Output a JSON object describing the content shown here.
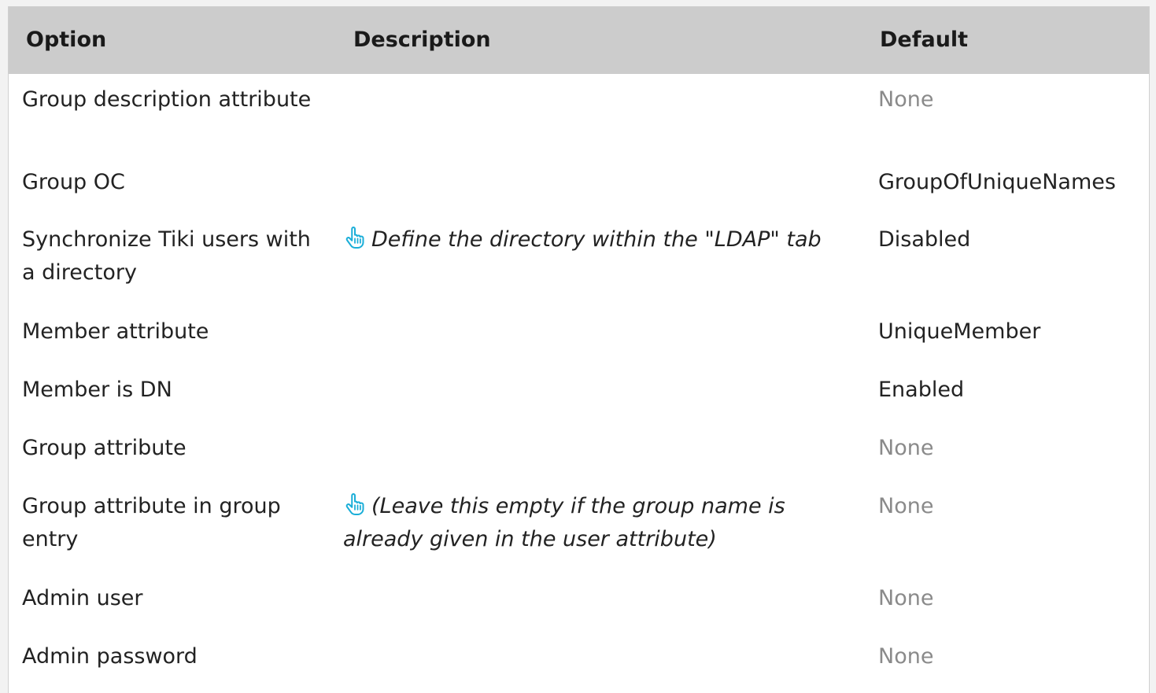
{
  "table": {
    "headers": {
      "option": "Option",
      "description": "Description",
      "default": "Default"
    },
    "rows": [
      {
        "option": "Group description attribute",
        "description": "",
        "default": "None",
        "default_muted": true
      },
      {
        "option": "Group OC",
        "description": "",
        "default": "GroupOfUniqueNames",
        "default_muted": false
      },
      {
        "option": "Synchronize Tiki users with a directory",
        "description": "Define the directory within the \"LDAP\" tab",
        "default": "Disabled",
        "default_muted": false,
        "has_hand_icon": true
      },
      {
        "option": "Member attribute",
        "description": "",
        "default": "UniqueMember",
        "default_muted": false
      },
      {
        "option": "Member is DN",
        "description": "",
        "default": "Enabled",
        "default_muted": false
      },
      {
        "option": "Group attribute",
        "description": "",
        "default": "None",
        "default_muted": true
      },
      {
        "option": "Group attribute in group entry",
        "description": "(Leave this empty if the group name is already given in the user attribute)",
        "default": "None",
        "default_muted": true,
        "has_hand_icon": true
      },
      {
        "option": "Admin user",
        "description": "",
        "default": "None",
        "default_muted": true
      },
      {
        "option": "Admin password",
        "description": "",
        "default": "None",
        "default_muted": true
      }
    ]
  },
  "icons": {
    "hand": "pointing-hand-icon"
  },
  "colors": {
    "header_bg": "#cccccc",
    "muted_text": "#8a8a8a",
    "icon_accent": "#1aaed8"
  }
}
